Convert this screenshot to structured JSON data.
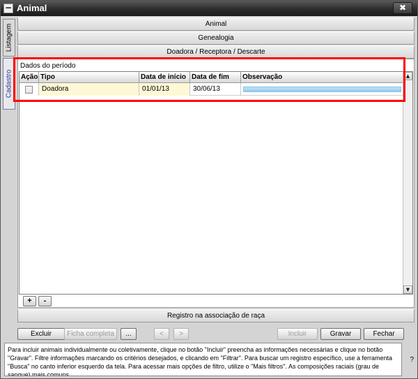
{
  "window": {
    "title": "Animal",
    "menu_symbol": "−",
    "close_symbol": "✖"
  },
  "side_tabs": [
    {
      "label": "Listagem"
    },
    {
      "label": "Cadastro"
    }
  ],
  "sections": {
    "animal": "Animal",
    "genealogia": "Genealogia",
    "doadora": "Doadora / Receptora / Descarte",
    "registro": "Registro na associação de raça"
  },
  "panel": {
    "label": "Dados do período",
    "columns": [
      "Ação",
      "Tipo",
      "Data de início",
      "Data de fim",
      "Observação"
    ],
    "rows": [
      {
        "acao": "",
        "tipo": "Doadora",
        "inicio": "01/01/13",
        "fim": "30/06/13",
        "observacao": ""
      }
    ],
    "add_label": "+",
    "remove_label": "-"
  },
  "scrollbar": {
    "up": "▲",
    "down": "▼"
  },
  "toolbar": {
    "excluir": "Excluir",
    "ficha": "Ficha completa",
    "more": "...",
    "prev": "<",
    "next": ">",
    "incluir": "Incluir",
    "gravar": "Gravar",
    "fechar": "Fechar"
  },
  "help": {
    "text": "Para incluir animais individualmente ou coletivamente, clique no botão \"Incluir\" preencha as informações necessárias e clique no botão \"Gravar\". Filtre informações marcando os critérios desejados, e clicando em \"Filtrar\". Para buscar um registro específico, use a ferramenta \"Busca\" no canto inferior esquerdo da tela. Para acessar mais opções de filtro, utilize o \"Mais filtros\". As composições raciais (grau de sangue) mais comuns",
    "question_mark": "?"
  },
  "colors": {
    "highlight": "#ff0000",
    "selected_cell": "#fff8d6",
    "progress": "#93cbee"
  }
}
